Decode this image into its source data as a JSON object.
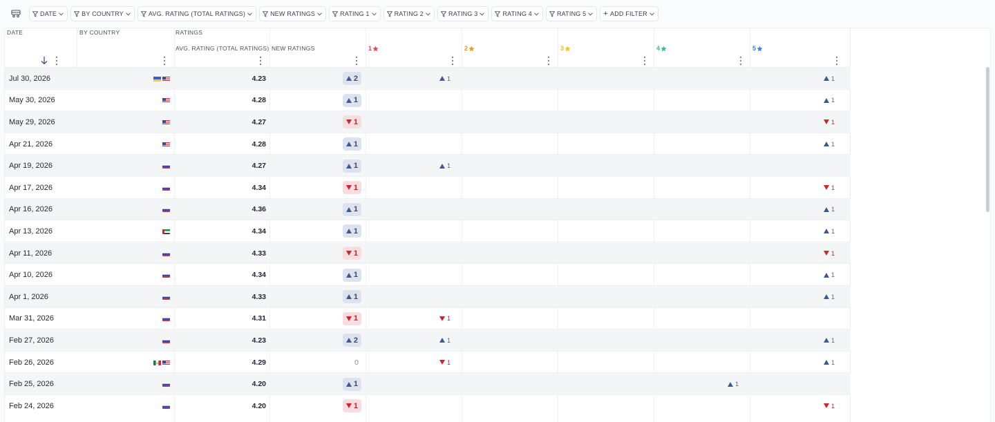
{
  "toolbar": {
    "filters": [
      {
        "label": "DATE"
      },
      {
        "label": "BY COUNTRY"
      },
      {
        "label": "AVG. RATING (TOTAL RATINGS)"
      },
      {
        "label": "NEW RATINGS"
      },
      {
        "label": "RATING 1"
      },
      {
        "label": "RATING 2"
      },
      {
        "label": "RATING 3"
      },
      {
        "label": "RATING 4"
      },
      {
        "label": "RATING 5"
      }
    ],
    "add_filter": "ADD FILTER"
  },
  "headers": {
    "date": "DATE",
    "by_country": "BY COUNTRY",
    "ratings_group": "RATINGS",
    "avg_rating": "AVG. RATING (TOTAL RATINGS)",
    "new_ratings": "NEW RATINGS",
    "stars": [
      {
        "label": "1",
        "color": "#e5484d"
      },
      {
        "label": "2",
        "color": "#f0912d"
      },
      {
        "label": "3",
        "color": "#f2c218"
      },
      {
        "label": "4",
        "color": "#2fbf8f"
      },
      {
        "label": "5",
        "color": "#3b7fe0"
      }
    ]
  },
  "colors": {
    "up_badge_bg": "#dde3ee",
    "down_badge_bg": "#f7dde0",
    "down_red": "#d2222d",
    "up_blue": "#3c5a8e"
  },
  "rows": [
    {
      "date": "Jul 30, 2026",
      "flags": [
        "ua",
        "us"
      ],
      "avg": "4.23",
      "new": {
        "dir": "up",
        "val": "2"
      },
      "r1": {
        "dir": "up",
        "val": "1"
      },
      "r2": null,
      "r3": null,
      "r4": null,
      "r5": {
        "dir": "up",
        "val": "1"
      }
    },
    {
      "date": "May 30, 2026",
      "flags": [
        "us"
      ],
      "avg": "4.28",
      "new": {
        "dir": "up",
        "val": "1"
      },
      "r1": null,
      "r2": null,
      "r3": null,
      "r4": null,
      "r5": {
        "dir": "up",
        "val": "1"
      }
    },
    {
      "date": "May 29, 2026",
      "flags": [
        "us"
      ],
      "avg": "4.27",
      "new": {
        "dir": "down",
        "val": "1"
      },
      "r1": null,
      "r2": null,
      "r3": null,
      "r4": null,
      "r5": {
        "dir": "down",
        "val": "1"
      }
    },
    {
      "date": "Apr 21, 2026",
      "flags": [
        "us"
      ],
      "avg": "4.28",
      "new": {
        "dir": "up",
        "val": "1"
      },
      "r1": null,
      "r2": null,
      "r3": null,
      "r4": null,
      "r5": {
        "dir": "up",
        "val": "1"
      }
    },
    {
      "date": "Apr 19, 2026",
      "flags": [
        "ru"
      ],
      "avg": "4.27",
      "new": {
        "dir": "up",
        "val": "1"
      },
      "r1": {
        "dir": "up",
        "val": "1"
      },
      "r2": null,
      "r3": null,
      "r4": null,
      "r5": null
    },
    {
      "date": "Apr 17, 2026",
      "flags": [
        "ru"
      ],
      "avg": "4.34",
      "new": {
        "dir": "down",
        "val": "1"
      },
      "r1": null,
      "r2": null,
      "r3": null,
      "r4": null,
      "r5": {
        "dir": "down",
        "val": "1"
      }
    },
    {
      "date": "Apr 16, 2026",
      "flags": [
        "ru"
      ],
      "avg": "4.36",
      "new": {
        "dir": "up",
        "val": "1"
      },
      "r1": null,
      "r2": null,
      "r3": null,
      "r4": null,
      "r5": {
        "dir": "up",
        "val": "1"
      }
    },
    {
      "date": "Apr 13, 2026",
      "flags": [
        "ae"
      ],
      "avg": "4.34",
      "new": {
        "dir": "up",
        "val": "1"
      },
      "r1": null,
      "r2": null,
      "r3": null,
      "r4": null,
      "r5": {
        "dir": "up",
        "val": "1"
      }
    },
    {
      "date": "Apr 11, 2026",
      "flags": [
        "ru"
      ],
      "avg": "4.33",
      "new": {
        "dir": "down",
        "val": "1"
      },
      "r1": null,
      "r2": null,
      "r3": null,
      "r4": null,
      "r5": {
        "dir": "down",
        "val": "1"
      }
    },
    {
      "date": "Apr 10, 2026",
      "flags": [
        "ru"
      ],
      "avg": "4.34",
      "new": {
        "dir": "up",
        "val": "1"
      },
      "r1": null,
      "r2": null,
      "r3": null,
      "r4": null,
      "r5": {
        "dir": "up",
        "val": "1"
      }
    },
    {
      "date": "Apr 1, 2026",
      "flags": [
        "ru"
      ],
      "avg": "4.33",
      "new": {
        "dir": "up",
        "val": "1"
      },
      "r1": null,
      "r2": null,
      "r3": null,
      "r4": null,
      "r5": {
        "dir": "up",
        "val": "1"
      }
    },
    {
      "date": "Mar 31, 2026",
      "flags": [
        "ru"
      ],
      "avg": "4.31",
      "new": {
        "dir": "down",
        "val": "1"
      },
      "r1": {
        "dir": "down",
        "val": "1"
      },
      "r2": null,
      "r3": null,
      "r4": null,
      "r5": null
    },
    {
      "date": "Feb 27, 2026",
      "flags": [
        "ru"
      ],
      "avg": "4.23",
      "new": {
        "dir": "up",
        "val": "2"
      },
      "r1": {
        "dir": "up",
        "val": "1"
      },
      "r2": null,
      "r3": null,
      "r4": null,
      "r5": {
        "dir": "up",
        "val": "1"
      }
    },
    {
      "date": "Feb 26, 2026",
      "flags": [
        "mx",
        "us"
      ],
      "avg": "4.29",
      "new": {
        "dir": "zero",
        "val": "0"
      },
      "r1": {
        "dir": "down",
        "val": "1"
      },
      "r2": null,
      "r3": null,
      "r4": null,
      "r5": {
        "dir": "up",
        "val": "1"
      }
    },
    {
      "date": "Feb 25, 2026",
      "flags": [
        "ru"
      ],
      "avg": "4.20",
      "new": {
        "dir": "up",
        "val": "1"
      },
      "r1": null,
      "r2": null,
      "r3": null,
      "r4": {
        "dir": "up",
        "val": "1"
      },
      "r5": null
    },
    {
      "date": "Feb 24, 2026",
      "flags": [
        "ru"
      ],
      "avg": "4.20",
      "new": {
        "dir": "down",
        "val": "1"
      },
      "r1": null,
      "r2": null,
      "r3": null,
      "r4": null,
      "r5": {
        "dir": "down",
        "val": "1"
      }
    }
  ]
}
